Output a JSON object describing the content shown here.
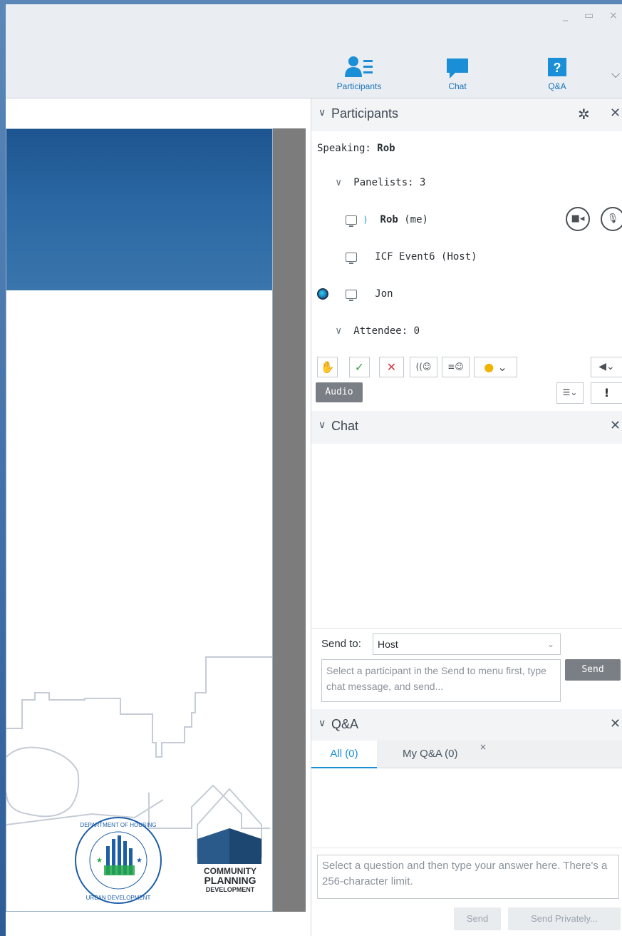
{
  "toolbar": {
    "tabs": [
      {
        "label": "Participants",
        "icon": "participants-icon"
      },
      {
        "label": "Chat",
        "icon": "chat-icon"
      },
      {
        "label": "Q&A",
        "icon": "qa-icon"
      }
    ],
    "window_controls": {
      "minimize": "_",
      "restore": "▭",
      "close": "×"
    }
  },
  "participants": {
    "title": "Participants",
    "speaking_label": "Speaking:",
    "speaking_name": "Rob",
    "panelists_label": "Panelists: 3",
    "panelists": [
      {
        "name": "Rob",
        "suffix": " (me)"
      },
      {
        "name": "ICF Event6 (Host)",
        "suffix": ""
      },
      {
        "name": "Jon",
        "suffix": ""
      }
    ],
    "attendee_label": "Attendee: 0",
    "audio_button": "Audio"
  },
  "chat": {
    "title": "Chat",
    "send_to_label": "Send to:",
    "send_to_value": "Host",
    "input_placeholder": "Select a participant in the Send to menu first, type chat message, and send...",
    "send_button": "Send"
  },
  "qa": {
    "title": "Q&A",
    "tabs": [
      {
        "label": "All (0)",
        "active": true
      },
      {
        "label": "My Q&A (0)",
        "active": false
      }
    ],
    "answer_placeholder": "Select a question and then type your answer here. There's a 256-character limit.",
    "send_button": "Send",
    "send_privately_button": "Send Privately..."
  },
  "slide": {
    "logo_text": [
      "COMMUNITY",
      "PLANNING",
      "DEVELOPMENT"
    ],
    "seal_text": "DEPARTMENT OF HOUSING AND URBAN DEVELOPMENT"
  },
  "colors": {
    "accent": "#1a8fd8",
    "slide_band": "#2a67a3"
  }
}
